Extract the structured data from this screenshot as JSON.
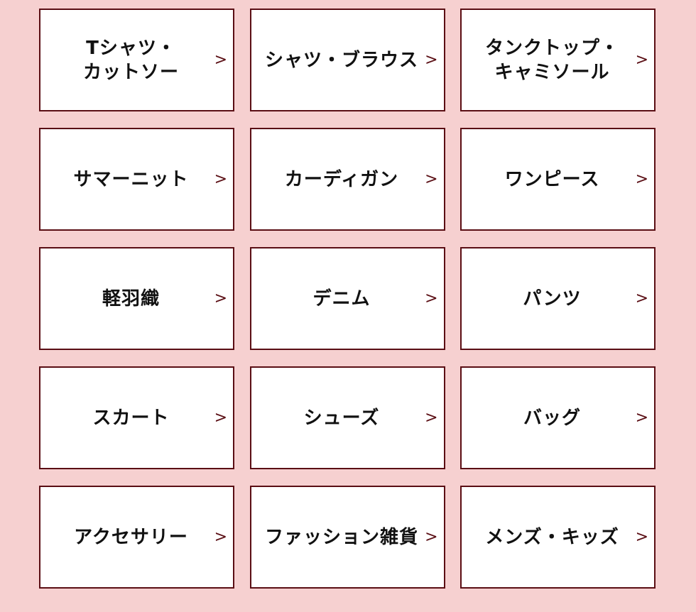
{
  "category_grid": {
    "arrow_glyph": ">",
    "border_color": "#5a0e14",
    "background_color": "#f6d0d0",
    "items": [
      {
        "label": "Tシャツ・\nカットソー"
      },
      {
        "label": "シャツ・ブラウス"
      },
      {
        "label": "タンクトップ・\nキャミソール"
      },
      {
        "label": "サマーニット"
      },
      {
        "label": "カーディガン"
      },
      {
        "label": "ワンピース"
      },
      {
        "label": "軽羽織"
      },
      {
        "label": "デニム"
      },
      {
        "label": "パンツ"
      },
      {
        "label": "スカート"
      },
      {
        "label": "シューズ"
      },
      {
        "label": "バッグ"
      },
      {
        "label": "アクセサリー"
      },
      {
        "label": "ファッション雑貨"
      },
      {
        "label": "メンズ・キッズ"
      }
    ]
  }
}
